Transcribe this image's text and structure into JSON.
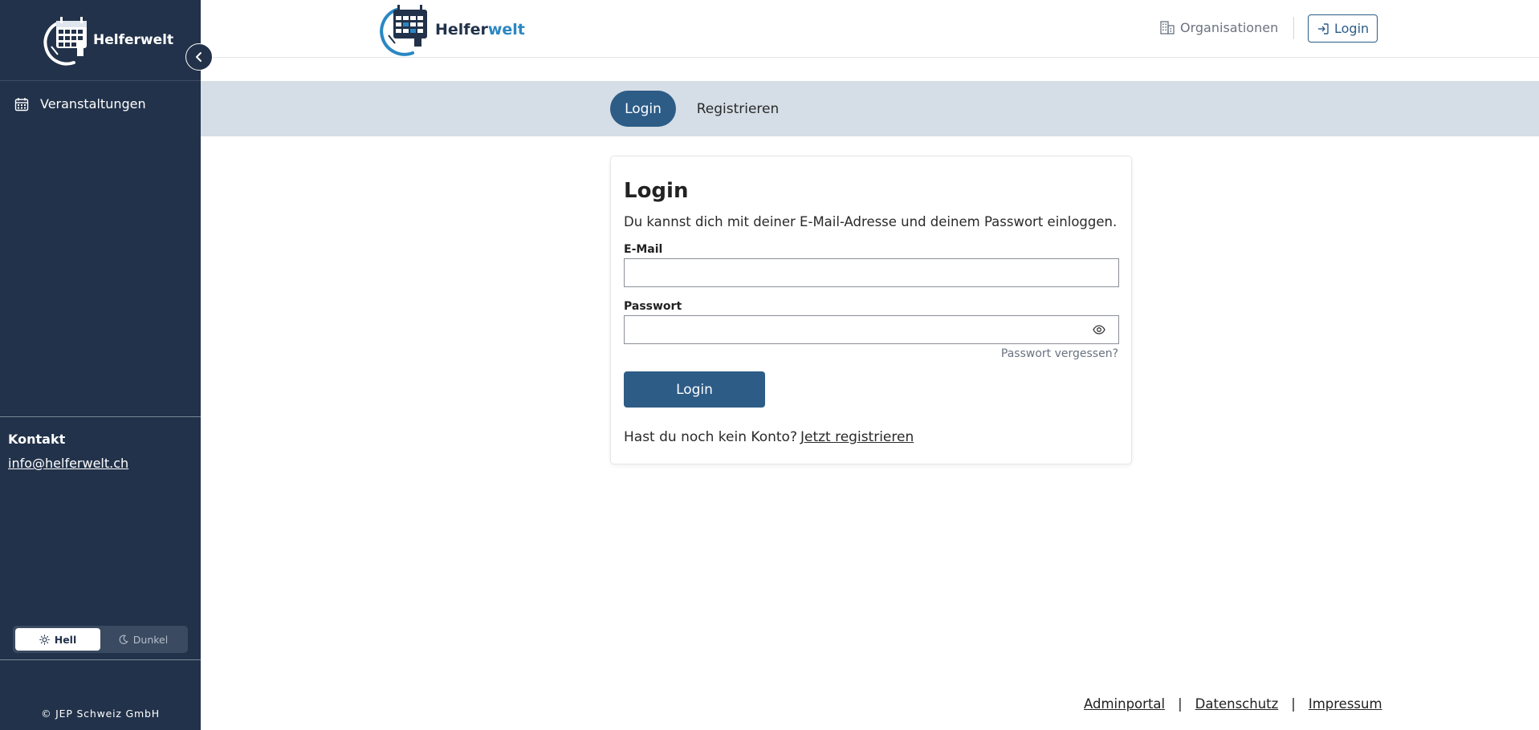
{
  "sidebar": {
    "logo_text": "Helferwelt",
    "nav_items": [
      {
        "label": "Veranstaltungen",
        "icon": "calendar-icon"
      }
    ],
    "contact_title": "Kontakt",
    "contact_email": "info@helferwelt.ch",
    "theme": {
      "light_label": "Hell",
      "dark_label": "Dunkel",
      "selected": "light"
    },
    "copyright": "© JEP Schweiz GmbH"
  },
  "header": {
    "logo_part1": "Helfer",
    "logo_part2": "welt",
    "organizations_label": "Organisationen",
    "login_label": "Login"
  },
  "tabs": [
    {
      "label": "Login",
      "active": true
    },
    {
      "label": "Registrieren",
      "active": false
    }
  ],
  "login_form": {
    "title": "Login",
    "description": "Du kannst dich mit deiner E-Mail-Adresse und deinem Passwort einloggen.",
    "email_label": "E-Mail",
    "email_value": "",
    "password_label": "Passwort",
    "password_value": "",
    "forgot_password": "Passwort vergessen?",
    "submit_label": "Login",
    "no_account_text": "Hast du noch kein Konto?",
    "register_link": "Jetzt registrieren"
  },
  "footer": {
    "links": [
      "Adminportal",
      "Datenschutz",
      "Impressum"
    ],
    "separator": "|"
  },
  "colors": {
    "sidebar_bg": "#22324a",
    "primary": "#2d5c87",
    "tab_band_bg": "#d5dee6",
    "logo_accent": "#2a87c3"
  }
}
